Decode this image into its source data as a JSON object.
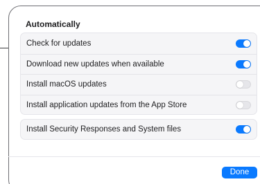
{
  "sheet": {
    "section_title": "Automatically",
    "main_rows": [
      {
        "label": "Check for updates",
        "enabled": true
      },
      {
        "label": "Download new updates when available",
        "enabled": true
      },
      {
        "label": "Install macOS updates",
        "enabled": false
      },
      {
        "label": "Install application updates from the App Store",
        "enabled": false
      }
    ],
    "security_rows": [
      {
        "label": "Install Security Responses and System files",
        "enabled": true
      }
    ],
    "done_label": "Done"
  },
  "colors": {
    "accent": "#0a7aff",
    "toggle_off": "#e6e6ea",
    "group_background": "#f5f5f7"
  }
}
